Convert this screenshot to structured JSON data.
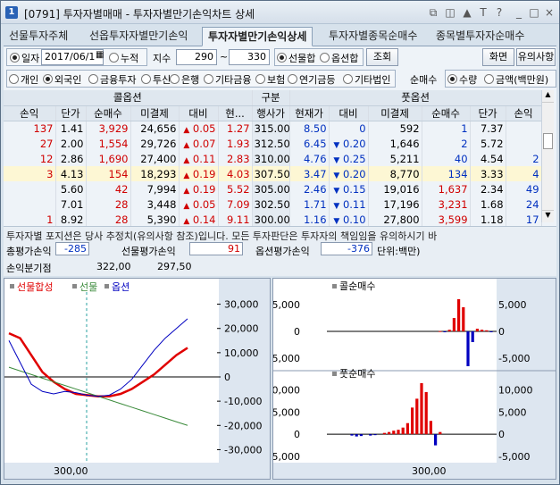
{
  "window": {
    "num": "1",
    "title": "[0791] 투자자별매매 - 투자자별만기손익차트 상세",
    "btns": [
      "⧉",
      "◫",
      "▲",
      "T",
      "?",
      "_",
      "□",
      "×"
    ]
  },
  "tabs": [
    {
      "label": "선물투자주체"
    },
    {
      "label": "선옵투자자별만기손익"
    },
    {
      "label": "투자자별만기손익상세"
    },
    {
      "label": "투자자별종목순매수"
    },
    {
      "label": "종목별투자자순매수"
    }
  ],
  "controls": {
    "date_radio": "일자",
    "date_value": "2017/06/1",
    "cumul_radio": "누적",
    "index_label": "지수",
    "index_from": "290",
    "tilde": "~",
    "index_to": "330",
    "futopt_label": "선물합",
    "option_label": "옵션합",
    "query_btn": "조회",
    "screen_btn": "화면",
    "notice_btn": "유의사항",
    "investors": [
      "개인",
      "외국인",
      "금융투자",
      "투신",
      "은행",
      "기타금융",
      "보험",
      "연기금등",
      "기타법인"
    ],
    "net_label": "순매수",
    "qty_label": "수량",
    "amt_label": "금액(백만원)"
  },
  "table": {
    "call_header": "콜옵션",
    "kind_header": "구분",
    "put_header": "풋옵션",
    "cols": [
      "손익",
      "단가",
      "순매수",
      "미결제",
      "대비",
      "현...",
      "행사가",
      "현재가",
      "대비",
      "미결제",
      "순매수",
      "단가",
      "손익"
    ],
    "rows": [
      [
        "137",
        "1.41",
        "3,929",
        "24,656",
        "0.05",
        "1.27",
        "315.00",
        "8.50",
        "0",
        "592",
        "1",
        "7.37",
        ""
      ],
      [
        "27",
        "2.00",
        "1,554",
        "29,726",
        "0.07",
        "1.93",
        "312.50",
        "6.45",
        "0.20",
        "1,646",
        "2",
        "5.72",
        ""
      ],
      [
        "12",
        "2.86",
        "1,690",
        "27,400",
        "0.11",
        "2.83",
        "310.00",
        "4.76",
        "0.25",
        "5,211",
        "40",
        "4.54",
        "2"
      ],
      [
        "3",
        "4.13",
        "154",
        "18,293",
        "0.19",
        "4.03",
        "307.50",
        "3.47",
        "0.20",
        "8,770",
        "134",
        "3.33",
        "4"
      ],
      [
        "",
        "5.60",
        "42",
        "7,994",
        "0.19",
        "5.52",
        "305.00",
        "2.46",
        "0.15",
        "19,016",
        "1,637",
        "2.34",
        "49"
      ],
      [
        "",
        "7.01",
        "28",
        "3,448",
        "0.05",
        "7.09",
        "302.50",
        "1.71",
        "0.11",
        "17,196",
        "3,231",
        "1.68",
        "24"
      ],
      [
        "1",
        "8.92",
        "28",
        "5,390",
        "0.14",
        "9.11",
        "300.00",
        "1.16",
        "0.10",
        "27,800",
        "3,599",
        "1.18",
        "17"
      ]
    ]
  },
  "info": {
    "notice": "투자자별 포지션은 당사 추정치(유의사항 참조)입니다. 모든 투자판단은 투자자의 책임임을 유의하시기 바",
    "total_label": "총평가손익",
    "total_value": "-285",
    "fut_label": "선물평가손익",
    "fut_value": "91",
    "opt_label": "옵션평가손익",
    "opt_value": "-376",
    "unit": "단위:백만)",
    "bep_label": "손익분기점",
    "bep1": "322,00",
    "bep2": "297,50"
  },
  "colors": {
    "red": "#e00000",
    "blue": "#0000c0",
    "green": "#3a8a3a",
    "cyan": "#2aa0a0"
  },
  "chart_data": [
    {
      "type": "line",
      "title": "",
      "legend": [
        "선물합성",
        "선물",
        "옵션"
      ],
      "yticks": [
        "30,000",
        "20,000",
        "10,000",
        "0",
        "-10,000",
        "-20,000",
        "-30,000"
      ],
      "xlabel": "300,00",
      "series": [
        {
          "name": "선물합성",
          "values": [
            18000,
            16000,
            9000,
            2000,
            -2000,
            -5000,
            -7000,
            -7500,
            -8000,
            -8000,
            -7000,
            -5000,
            -2000,
            1000,
            5000,
            9000,
            12000
          ]
        },
        {
          "name": "선물",
          "values": [
            4000,
            2500,
            1000,
            -500,
            -2000,
            -3500,
            -5000,
            -6500,
            -8000,
            -9500,
            -11000,
            -12500,
            -14000,
            -15500,
            -17000,
            -18500,
            -20000
          ]
        },
        {
          "name": "옵션",
          "values": [
            15000,
            6000,
            -3000,
            -6000,
            -7000,
            -6000,
            -6500,
            -7500,
            -8000,
            -7500,
            -5000,
            -1000,
            5000,
            11000,
            16000,
            20000,
            24000
          ]
        }
      ]
    },
    {
      "type": "bar",
      "title": "콜순매수",
      "yticks": [
        "5,000",
        "0",
        "-5,000"
      ],
      "values": [
        0,
        0,
        0,
        0,
        0,
        0,
        0,
        0,
        0,
        0,
        0,
        0,
        0,
        0,
        0,
        0,
        0,
        0,
        0,
        0,
        0,
        50,
        -100,
        300,
        2500,
        6000,
        4500,
        -6500,
        -2000,
        500,
        300,
        200,
        -100
      ]
    },
    {
      "type": "bar",
      "title": "풋순매수",
      "yticks": [
        "10,000",
        "5,000",
        "0",
        "-5,000"
      ],
      "values": [
        0,
        0,
        -300,
        -500,
        -400,
        0,
        -300,
        -200,
        0,
        300,
        500,
        800,
        1000,
        1500,
        2500,
        6000,
        8000,
        11500,
        9500,
        3000,
        -2500,
        500,
        0,
        0,
        0,
        0,
        0,
        0,
        0,
        0,
        0,
        0,
        0
      ],
      "xlabel": "300,00"
    }
  ]
}
